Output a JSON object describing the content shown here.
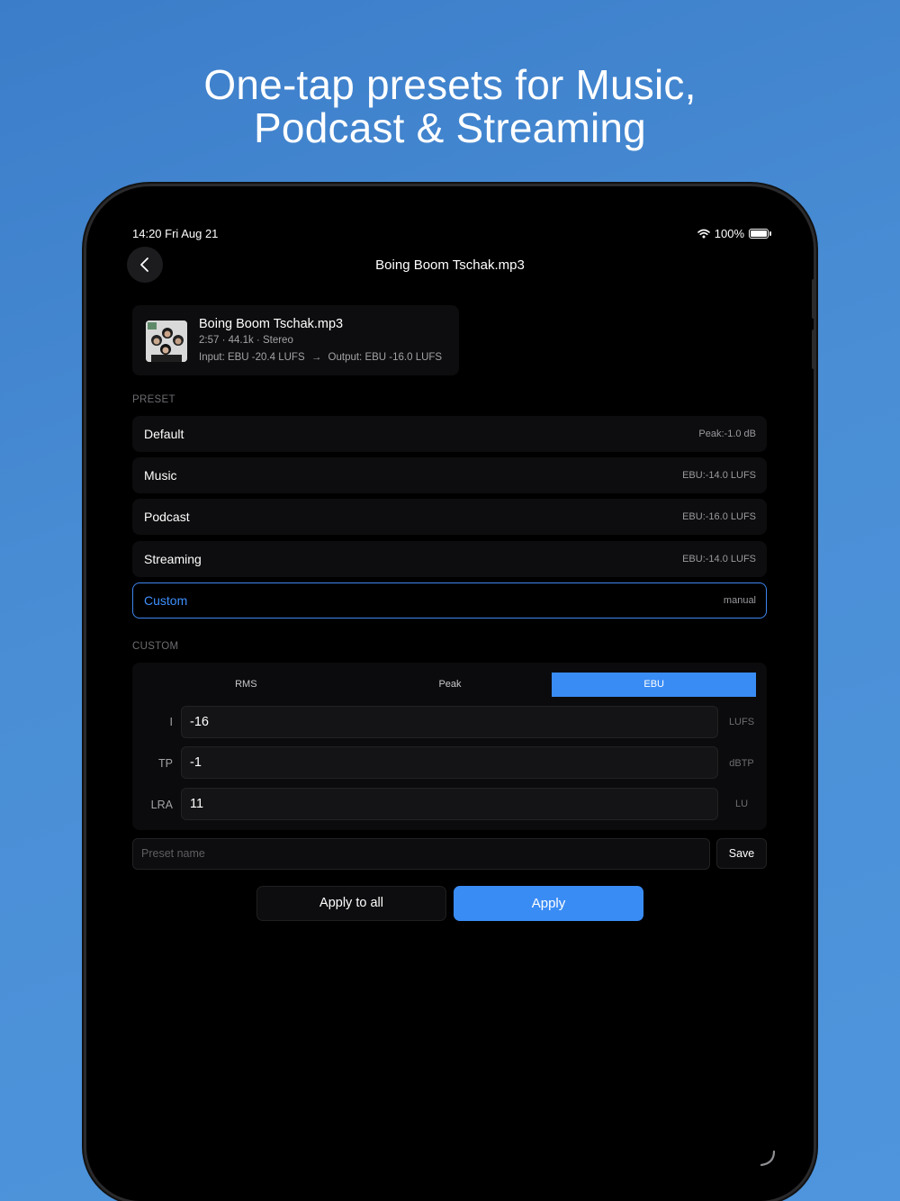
{
  "headline": {
    "line1": "One-tap presets for Music,",
    "line2": "Podcast & Streaming"
  },
  "status_bar": {
    "time_date": "14:20  Fri Aug 21",
    "battery": "100%"
  },
  "nav": {
    "back_icon": "chevron-left-icon",
    "title": "Boing Boom Tschak.mp3"
  },
  "file": {
    "name": "Boing Boom Tschak.mp3",
    "meta": "2:57 · 44.1k · Stereo",
    "input": "Input: EBU -20.4 LUFS",
    "arrow": "→",
    "output": "Output: EBU -16.0 LUFS"
  },
  "preset_section": {
    "label": "PRESET",
    "items": [
      {
        "name": "Default",
        "value": "Peak:-1.0 dB"
      },
      {
        "name": "Music",
        "value": "EBU:-14.0 LUFS"
      },
      {
        "name": "Podcast",
        "value": "EBU:-16.0 LUFS"
      },
      {
        "name": "Streaming",
        "value": "EBU:-14.0 LUFS"
      },
      {
        "name": "Custom",
        "value": "manual",
        "selected": true
      }
    ]
  },
  "custom_section": {
    "label": "CUSTOM",
    "modes": [
      "RMS",
      "Peak",
      "EBU"
    ],
    "active_mode": "EBU",
    "fields": [
      {
        "label": "I",
        "value": "-16",
        "unit": "LUFS"
      },
      {
        "label": "TP",
        "value": "-1",
        "unit": "dBTP"
      },
      {
        "label": "LRA",
        "value": "11",
        "unit": "LU"
      }
    ],
    "preset_name_placeholder": "Preset name",
    "save_label": "Save"
  },
  "actions": {
    "apply_all_label": "Apply to all",
    "apply_label": "Apply"
  },
  "colors": {
    "accent": "#3a8cf5",
    "background_gradient": "#4a8fd6",
    "screen": "#000000"
  }
}
